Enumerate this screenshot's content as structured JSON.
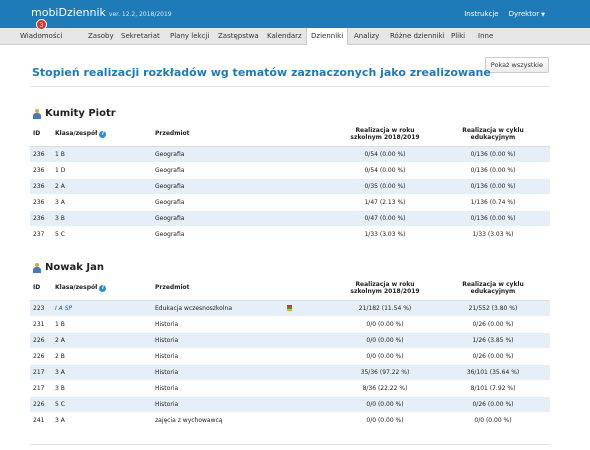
{
  "app": {
    "brand_a": "mobi",
    "brand_b": "Dziennik",
    "version": "ver. 12.2, 2018/2019"
  },
  "topnav": {
    "instrukcje": "Instrukcje",
    "user": "Dyrektor"
  },
  "nav": {
    "badge": "3",
    "items": [
      "Wiadomości",
      "Zasoby",
      "Sekretariat",
      "Plany lekcji",
      "Zastępstwa",
      "Kalendarz",
      "Dzienniki",
      "Analizy",
      "Różne dzienniki",
      "Pliki",
      "Inne"
    ],
    "active": "Dzienniki"
  },
  "page": {
    "title": "Stopień realizacji rozkładów wg tematów zaznaczonych jako zrealizowane",
    "show_all": "Pokaż wszystkie"
  },
  "columns": {
    "id": "ID",
    "class": "Klasa/zespół",
    "subject": "Przedmiot",
    "year_l1": "Realizacja w roku",
    "year_l2": "szkolnym 2018/2019",
    "cycle_l1": "Realizacja w cyklu",
    "cycle_l2": "edukacyjnym"
  },
  "teachers": [
    {
      "name": "Kumity Piotr",
      "rows": [
        {
          "id": "236",
          "class": "1 B",
          "subject": "Geografia",
          "year": "0/54 (0.00 %)",
          "cycle": "0/136 (0.00 %)"
        },
        {
          "id": "236",
          "class": "1 D",
          "subject": "Geografia",
          "year": "0/54 (0.00 %)",
          "cycle": "0/136 (0.00 %)"
        },
        {
          "id": "236",
          "class": "2 A",
          "subject": "Geografia",
          "year": "0/35 (0.00 %)",
          "cycle": "0/136 (0.00 %)"
        },
        {
          "id": "236",
          "class": "3 A",
          "subject": "Geografia",
          "year": "1/47 (2.13 %)",
          "cycle": "1/136 (0.74 %)"
        },
        {
          "id": "236",
          "class": "3 B",
          "subject": "Geografia",
          "year": "0/47 (0.00 %)",
          "cycle": "0/136 (0.00 %)"
        },
        {
          "id": "237",
          "class": "5 C",
          "subject": "Geografia",
          "year": "1/33 (3.03 %)",
          "cycle": "1/33 (3.03 %)"
        }
      ]
    },
    {
      "name": "Nowak Jan",
      "rows": [
        {
          "id": "223",
          "class": "I A SP",
          "subject": "Edukacja wczesnoszkolna",
          "year": "21/182 (11.54 %)",
          "cycle": "21/552 (3.80 %)",
          "italic_class": true,
          "icon": true
        },
        {
          "id": "231",
          "class": "1 B",
          "subject": "Historia",
          "year": "0/0 (0.00 %)",
          "cycle": "0/26 (0.00 %)"
        },
        {
          "id": "226",
          "class": "2 A",
          "subject": "Historia",
          "year": "0/0 (0.00 %)",
          "cycle": "1/26 (3.85 %)"
        },
        {
          "id": "226",
          "class": "2 B",
          "subject": "Historia",
          "year": "0/0 (0.00 %)",
          "cycle": "0/26 (0.00 %)"
        },
        {
          "id": "217",
          "class": "3 A",
          "subject": "Historia",
          "year": "35/36 (97.22 %)",
          "cycle": "36/101 (35.64 %)"
        },
        {
          "id": "217",
          "class": "3 B",
          "subject": "Historia",
          "year": "8/36 (22.22 %)",
          "cycle": "8/101 (7.92 %)"
        },
        {
          "id": "226",
          "class": "5 C",
          "subject": "Historia",
          "year": "0/0 (0.00 %)",
          "cycle": "0/26 (0.00 %)"
        },
        {
          "id": "241",
          "class": "3 A",
          "subject": "zajęcia z wychowawcą",
          "year": "0/0 (0.00 %)",
          "cycle": "0/0 (0.00 %)"
        }
      ]
    }
  ]
}
